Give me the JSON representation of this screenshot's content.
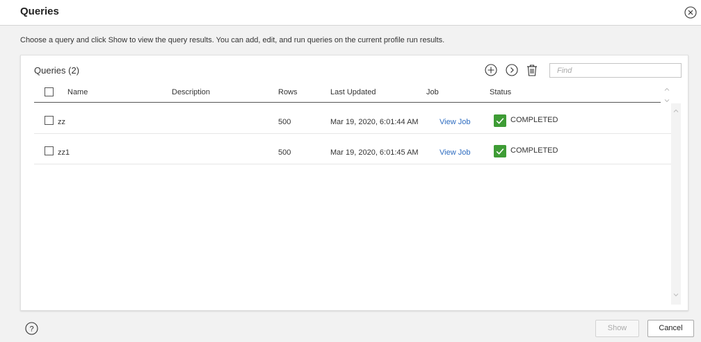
{
  "dialog": {
    "title": "Queries",
    "instructions": "Choose a query and click Show to view the query results. You can add, edit, and run queries on the current profile run results."
  },
  "card": {
    "title": "Queries (2)",
    "find_placeholder": "Find",
    "toolbar_icons": [
      "add-icon",
      "run-icon",
      "delete-icon"
    ]
  },
  "table": {
    "columns": {
      "name": "Name",
      "description": "Description",
      "rows": "Rows",
      "last_updated": "Last Updated",
      "job": "Job",
      "status": "Status"
    },
    "rows": [
      {
        "name": "zz",
        "description": "",
        "rows": "500",
        "last_updated": "Mar 19, 2020, 6:01:44 AM",
        "job": "View Job",
        "status": "COMPLETED"
      },
      {
        "name": "zz1",
        "description": "",
        "rows": "500",
        "last_updated": "Mar 19, 2020, 6:01:45 AM",
        "job": "View Job",
        "status": "COMPLETED"
      }
    ]
  },
  "footer": {
    "show_label": "Show",
    "cancel_label": "Cancel"
  },
  "colors": {
    "link": "#2d6cc0",
    "status_completed": "#3e9c35"
  }
}
